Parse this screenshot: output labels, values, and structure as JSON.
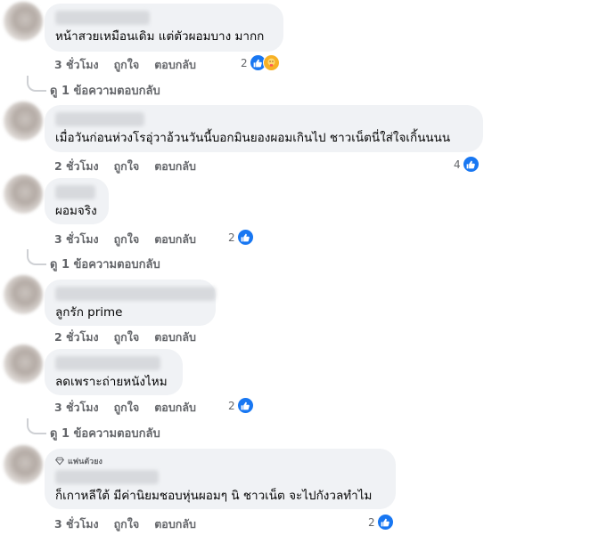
{
  "comments": [
    {
      "text": "หน้าสวยเหมือนเดิม แต่ตัวผอมบาง มากก",
      "time": "3 ชั่วโมง",
      "like_label": "ถูกใจ",
      "reply_label": "ตอบกลับ",
      "reaction_count": "2",
      "reactions": [
        "like-icon",
        "care-icon"
      ],
      "view_replies": "ดู 1 ข้อความตอบกลับ"
    },
    {
      "text": "เมื่อวันก่อนห่วงโรอุ่วาอ้วนวันนี้บอกมินยองผอมเกินไป ชาวเน็ตนี่ใส่ใจเกิ้นนนน",
      "time": "2 ชั่วโมง",
      "like_label": "ถูกใจ",
      "reply_label": "ตอบกลับ",
      "reaction_count": "4",
      "reactions": [
        "like-icon"
      ]
    },
    {
      "text": "ผอมจริง",
      "time": "3 ชั่วโมง",
      "like_label": "ถูกใจ",
      "reply_label": "ตอบกลับ",
      "reaction_count": "2",
      "reactions": [
        "like-icon"
      ],
      "view_replies": "ดู 1 ข้อความตอบกลับ"
    },
    {
      "text": "ลูกรัก prime",
      "time": "2 ชั่วโมง",
      "like_label": "ถูกใจ",
      "reply_label": "ตอบกลับ"
    },
    {
      "text": "ลดเพราะถ่ายหนังไหม",
      "time": "3 ชั่วโมง",
      "like_label": "ถูกใจ",
      "reply_label": "ตอบกลับ",
      "reaction_count": "2",
      "reactions": [
        "like-icon"
      ],
      "view_replies": "ดู 1 ข้อความตอบกลับ"
    },
    {
      "badge": "แฟนตัวยง",
      "text": "ก็เกาหลีใต้ มีค่านิยมชอบหุ่นผอมๆ นิ ชาวเน็ต จะไปกังวลทำไม",
      "time": "3 ชั่วโมง",
      "like_label": "ถูกใจ",
      "reply_label": "ตอบกลับ",
      "reaction_count": "2",
      "reactions": [
        "like-icon"
      ]
    }
  ],
  "colors": {
    "bubble": "#f0f2f5",
    "meta_text": "#65676b",
    "like_blue": "#1877f2",
    "care_yellow": "#f7b125"
  }
}
